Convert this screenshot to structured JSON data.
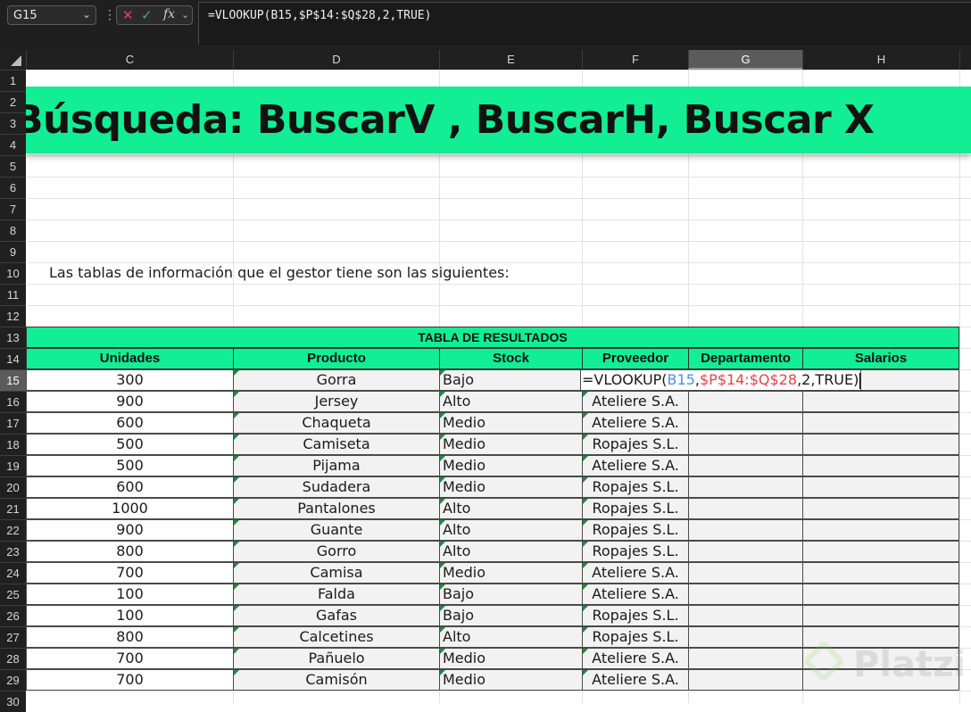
{
  "toolbar": {
    "name_box": "G15",
    "formula": "=VLOOKUP(B15,$P$14:$Q$28,2,TRUE)"
  },
  "columns": [
    "C",
    "D",
    "E",
    "F",
    "G",
    "H"
  ],
  "selected_column": "G",
  "rows": [
    "1",
    "2",
    "3",
    "4",
    "5",
    "6",
    "7",
    "8",
    "9",
    "10",
    "11",
    "12",
    "13",
    "14",
    "15",
    "16",
    "17",
    "18",
    "19",
    "20",
    "21",
    "22",
    "23",
    "24",
    "25",
    "26",
    "27",
    "28",
    "29",
    "30"
  ],
  "selected_row": "15",
  "banner": {
    "title": "Búsqueda: BuscarV , BuscarH, Buscar X"
  },
  "intro_text": "Las tablas de información que el gestor tiene son las siguientes:",
  "table": {
    "title": "TABLA DE RESULTADOS",
    "headers": [
      "Unidades",
      "Producto",
      "Stock",
      "Proveedor",
      "Departamento",
      "Salarios"
    ],
    "rows": [
      {
        "unidades": "300",
        "producto": "Gorra",
        "stock": "Bajo",
        "proveedor": ""
      },
      {
        "unidades": "900",
        "producto": "Jersey",
        "stock": "Alto",
        "proveedor": "Ateliere S.A."
      },
      {
        "unidades": "600",
        "producto": "Chaqueta",
        "stock": "Medio",
        "proveedor": "Ateliere S.A."
      },
      {
        "unidades": "500",
        "producto": "Camiseta",
        "stock": "Medio",
        "proveedor": "Ropajes S.L."
      },
      {
        "unidades": "500",
        "producto": "Pijama",
        "stock": "Medio",
        "proveedor": "Ateliere S.A."
      },
      {
        "unidades": "600",
        "producto": "Sudadera",
        "stock": "Medio",
        "proveedor": "Ropajes S.L."
      },
      {
        "unidades": "1000",
        "producto": "Pantalones",
        "stock": "Alto",
        "proveedor": "Ropajes S.L."
      },
      {
        "unidades": "900",
        "producto": "Guante",
        "stock": "Alto",
        "proveedor": "Ropajes S.L."
      },
      {
        "unidades": "800",
        "producto": "Gorro",
        "stock": "Alto",
        "proveedor": "Ropajes S.L."
      },
      {
        "unidades": "700",
        "producto": "Camisa",
        "stock": "Medio",
        "proveedor": "Ateliere S.A."
      },
      {
        "unidades": "100",
        "producto": "Falda",
        "stock": "Bajo",
        "proveedor": "Ateliere S.A."
      },
      {
        "unidades": "100",
        "producto": "Gafas",
        "stock": "Bajo",
        "proveedor": "Ropajes S.L."
      },
      {
        "unidades": "800",
        "producto": "Calcetines",
        "stock": "Alto",
        "proveedor": "Ropajes S.L."
      },
      {
        "unidades": "700",
        "producto": "Pañuelo",
        "stock": "Medio",
        "proveedor": "Ateliere S.A."
      },
      {
        "unidades": "700",
        "producto": "Camisón",
        "stock": "Medio",
        "proveedor": "Ateliere S.A."
      }
    ]
  },
  "cell_edit": {
    "prefix": "=VLOOKUP(",
    "ref1": "B15",
    "comma1": ",",
    "ref2": "$P$14:$Q$28",
    "suffix": ",2,TRUE)"
  },
  "watermark": "Platzi",
  "colors": {
    "accent": "#12ee93",
    "ref1": "#4f8fe6",
    "ref2": "#e0454a"
  }
}
